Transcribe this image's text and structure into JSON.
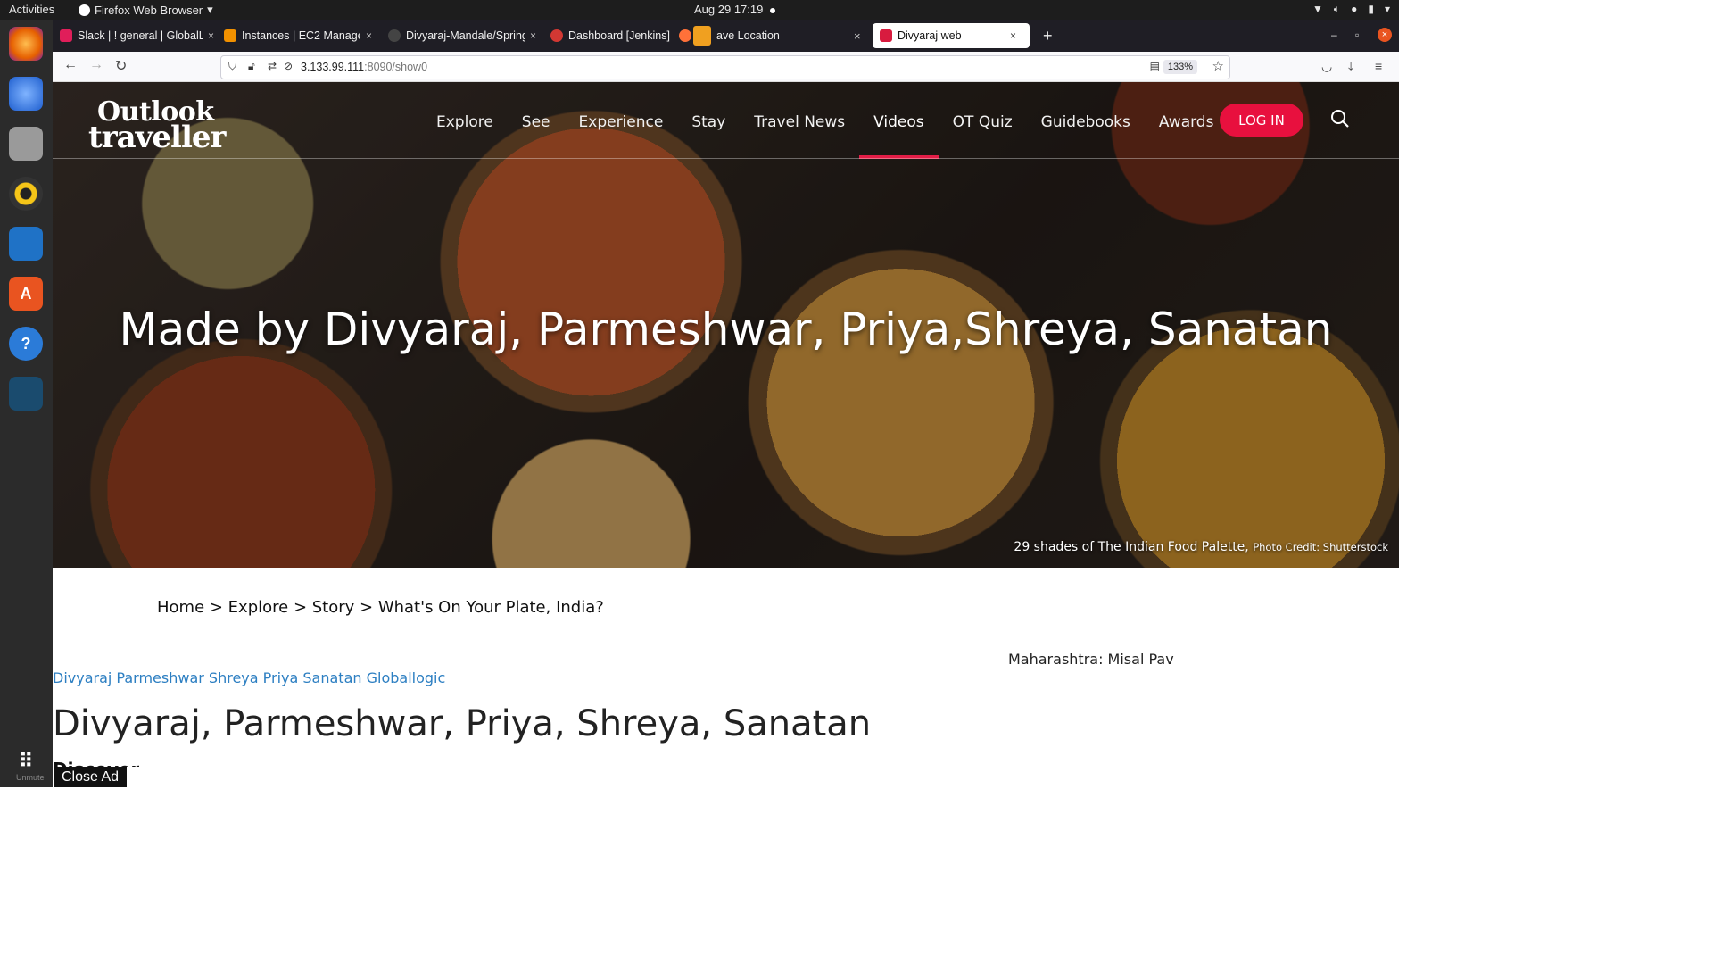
{
  "system": {
    "activities": "Activities",
    "app_name": "Firefox Web Browser",
    "datetime": "Aug 29  17:19"
  },
  "tabs": [
    {
      "label": "Slack | ! general | GlobalL",
      "color": "#e01e5a"
    },
    {
      "label": "Instances | EC2 Managem",
      "color": "#f29100"
    },
    {
      "label": "Divyaraj-Mandale/Spring",
      "color": "#444444"
    },
    {
      "label": "Dashboard [Jenkins]",
      "color": "#d33833"
    },
    {
      "label": "ave Location",
      "color": "#ff7139"
    },
    {
      "label": "Divyaraj web",
      "color": "#d81b3f"
    }
  ],
  "address_bar": {
    "host": "3.133.99.111",
    "path": ":8090/show0",
    "zoom": "133%"
  },
  "site": {
    "logo_line1": "Outlook",
    "logo_line2": "traveller",
    "menu": [
      "Explore",
      "See",
      "Experience",
      "Stay",
      "Travel News",
      "Videos",
      "OT Quiz",
      "Guidebooks",
      "Awards"
    ],
    "active_menu": "Videos",
    "login_label": "LOG IN",
    "hero_headline": "Made by Divyaraj, Parmeshwar, Priya,Shreya, Sanatan",
    "hero_caption": "29 shades of The Indian Food Palette,",
    "hero_credit": "Photo Credit: Shutterstock",
    "breadcrumb": "Home > Explore > Story > What's On Your Plate, India?",
    "tags_line": "Divyaraj Parmeshwar Shreya Priya Sanatan Globallogic",
    "side_item": "Maharashtra: Misal Pav",
    "article_title": "Divyaraj, Parmeshwar, Priya, Shreya, Sanatan",
    "article_subtitle": "Discover",
    "close_ad": "Close Ad",
    "unmute": "Unmute"
  },
  "colors": {
    "accent": "#e8103e",
    "link": "#2d7fc2"
  }
}
